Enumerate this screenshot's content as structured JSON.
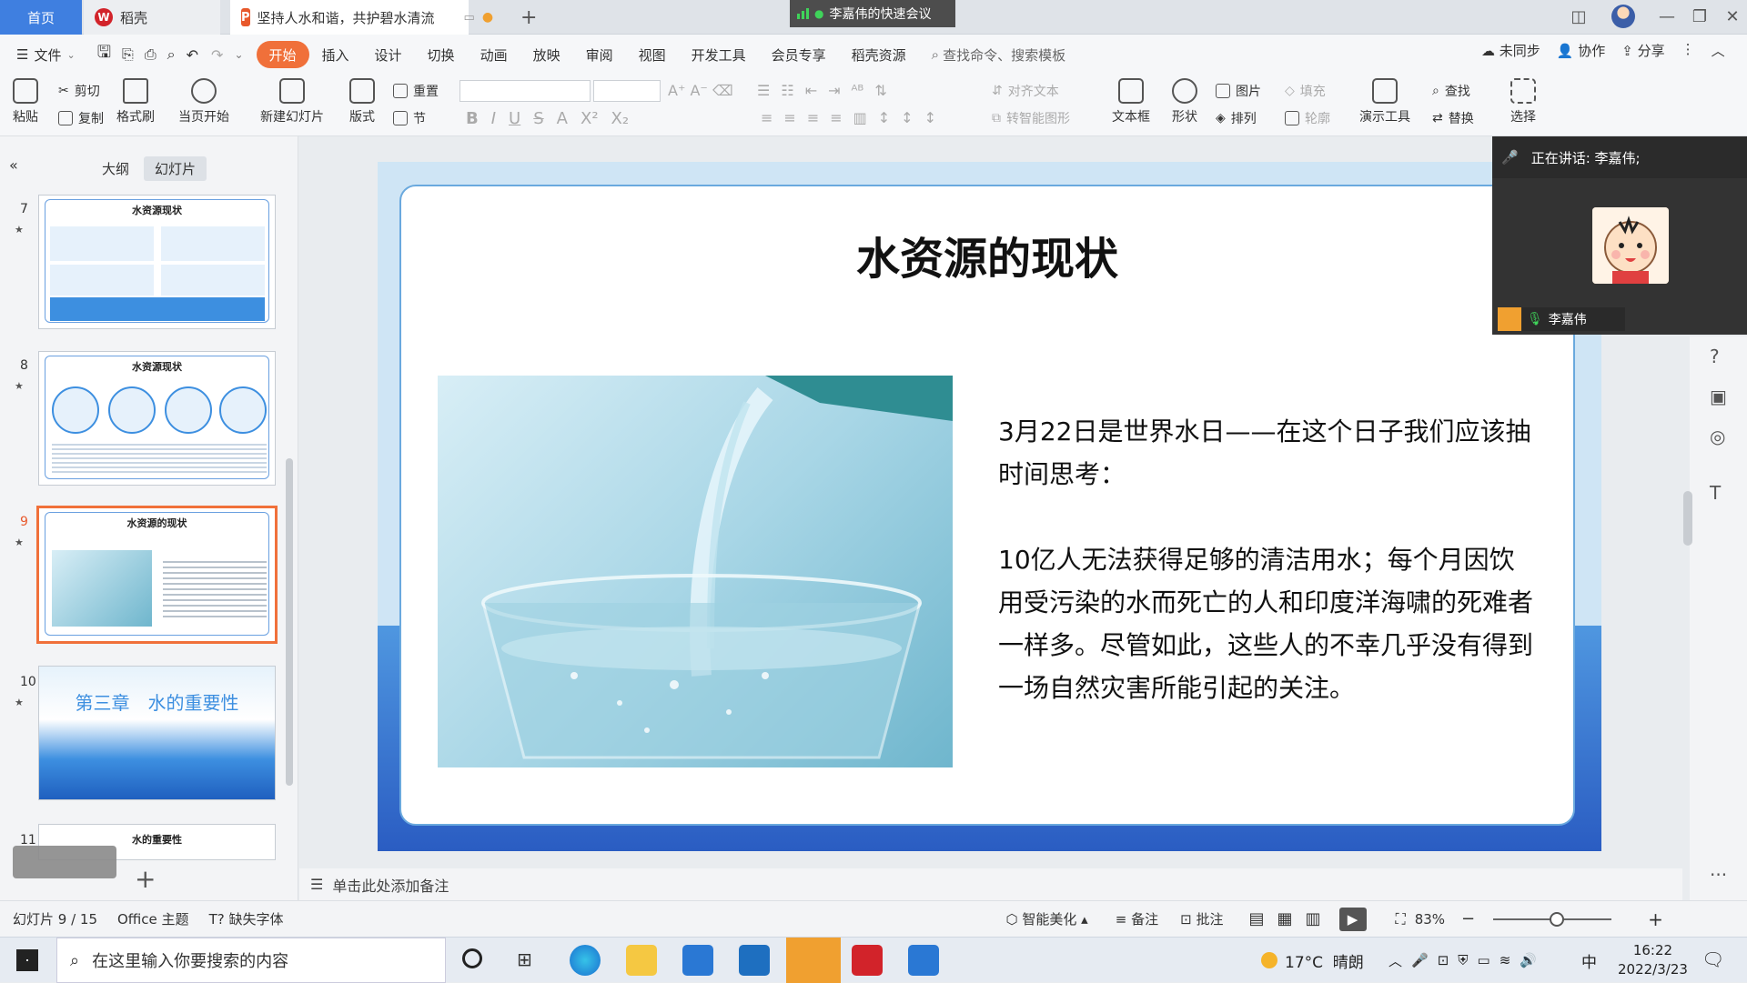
{
  "tabs": {
    "home": "首页",
    "daoke": "稻壳",
    "doc": "坚持人水和谐，共护碧水清流"
  },
  "meeting": {
    "title": "李嘉伟的快速会议",
    "speaking": "正在讲话: 李嘉伟;",
    "participant": "李嘉伟"
  },
  "menu": {
    "file": "文件",
    "items": [
      "开始",
      "插入",
      "设计",
      "切换",
      "动画",
      "放映",
      "审阅",
      "视图",
      "开发工具",
      "会员专享",
      "稻壳资源"
    ],
    "search_placeholder": "查找命令、搜索模板",
    "unsynced": "未同步",
    "collab": "协作",
    "share": "分享"
  },
  "ribbon": {
    "paste": "粘贴",
    "cut": "剪切",
    "copy": "复制",
    "format_painter": "格式刷",
    "play_current": "当页开始",
    "new_slide": "新建幻灯片",
    "layout": "版式",
    "reset": "重置",
    "section": "节",
    "align_text": "对齐文本",
    "smart_shape": "转智能图形",
    "textbox": "文本框",
    "shape": "形状",
    "picture": "图片",
    "fill": "填充",
    "arrange": "排列",
    "outline": "轮廓",
    "present_tools": "演示工具",
    "find": "查找",
    "replace": "替换",
    "select": "选择"
  },
  "panel": {
    "tab_outline": "大纲",
    "tab_slides": "幻灯片"
  },
  "thumbnails": [
    {
      "num": "7",
      "title": "水资源现状"
    },
    {
      "num": "8",
      "title": "水资源现状"
    },
    {
      "num": "9",
      "title": "水资源的现状"
    },
    {
      "num": "10",
      "title": "第三章　水的重要性"
    },
    {
      "num": "11",
      "title": "水的重要性"
    }
  ],
  "slide": {
    "title": "水资源的现状",
    "para1": "3月22日是世界水日——在这个日子我们应该抽时间思考：",
    "para2": "10亿人无法获得足够的清洁用水；每个月因饮用受污染的水而死亡的人和印度洋海啸的死难者一样多。尽管如此，这些人的不幸几乎没有得到一场自然灾害所能引起的关注。"
  },
  "notes_placeholder": "单击此处添加备注",
  "status": {
    "slide_count": "幻灯片 9 / 15",
    "theme": "Office 主题",
    "missing_font": "缺失字体",
    "smart_beautify": "智能美化",
    "notes": "备注",
    "comments": "批注",
    "zoom": "83%"
  },
  "taskbar": {
    "search_placeholder": "在这里输入你要搜索的内容",
    "weather": "17°C  晴朗",
    "ime": "中",
    "time": "16:22",
    "date": "2022/3/23"
  }
}
